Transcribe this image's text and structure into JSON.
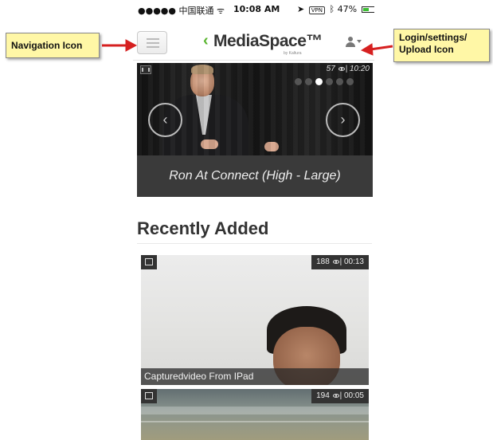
{
  "status_bar": {
    "carrier": "●●●●● 中国联通 ᯤ",
    "time": "10:08 AM",
    "vpn": "VPN",
    "battery": "47%",
    "battery_level": 0.47
  },
  "header": {
    "logo_text": "MediaSpace™",
    "logo_sub": "by Kaltura"
  },
  "carousel": {
    "views": "57",
    "duration": "10:20",
    "caption": "Ron At Connect (High - Large)",
    "dots_total": 6,
    "active_index": 2
  },
  "recently_added": {
    "title": "Recently Added",
    "items": [
      {
        "views": "188",
        "duration": "00:13",
        "caption": "Capturedvideo From IPad"
      },
      {
        "views": "194",
        "duration": "00:05",
        "caption": ""
      }
    ]
  },
  "annotations": {
    "nav": "Navigation Icon",
    "login": "Login/settings/ Upload Icon"
  },
  "colors": {
    "logo_accent": "#59b52f",
    "callout_bg": "#fff7a6",
    "arrow": "#d62020"
  },
  "icons": [
    "menu-icon",
    "user-icon",
    "film-icon",
    "eye-icon",
    "chevron-left-icon",
    "chevron-right-icon",
    "wifi-icon",
    "location-icon",
    "bluetooth-icon",
    "battery-icon"
  ]
}
